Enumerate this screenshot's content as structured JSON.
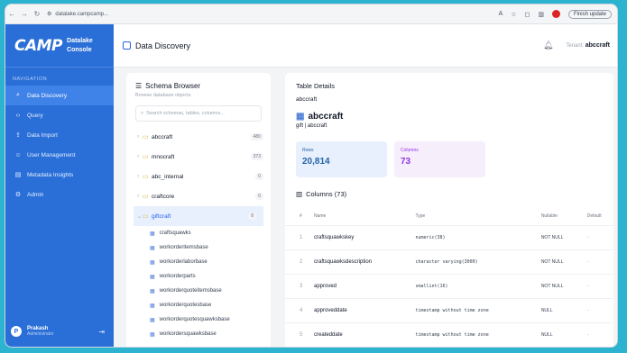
{
  "browser": {
    "url": "datalake.campcamp...",
    "update_label": "Finish update"
  },
  "brand": {
    "logo": "CAMP",
    "line1": "Datalake",
    "line2": "Console"
  },
  "sidebar": {
    "heading": "NAVIGATION",
    "items": [
      {
        "label": "Data Discovery",
        "icon": "search-icon"
      },
      {
        "label": "Query",
        "icon": "code-icon"
      },
      {
        "label": "Data Import",
        "icon": "upload-icon"
      },
      {
        "label": "User Management",
        "icon": "users-icon"
      },
      {
        "label": "Metadata Insights",
        "icon": "document-icon"
      },
      {
        "label": "Admin",
        "icon": "gear-icon"
      }
    ],
    "user": {
      "initial": "P",
      "name": "Prakash",
      "role": "Administrator"
    }
  },
  "header": {
    "title": "Data Discovery",
    "welcome_prefix": "Tenant:",
    "username": "abccraft"
  },
  "schema_browser": {
    "title": "Schema Browser",
    "subtitle": "Browse database objects",
    "search_placeholder": "Search schemas, tables, columns...",
    "schemas": [
      {
        "name": "abccraft",
        "count": "480"
      },
      {
        "name": "mnocraft",
        "count": "373"
      },
      {
        "name": "abc_internal",
        "count": "0"
      },
      {
        "name": "craftcore",
        "count": "0"
      },
      {
        "name": "giftcraft",
        "count": "8"
      }
    ],
    "tables": [
      "craftsquawks",
      "workorderitemsbase",
      "workorderlaborbase",
      "workorderparts",
      "workorderquoteitemsbase",
      "workorderquotesbase",
      "workorderquotesquawksbase",
      "workordersquawksbase"
    ]
  },
  "table_details": {
    "title": "Table Details",
    "database": "abccraft",
    "table_name": "abccraft",
    "path": "gift | abccraft",
    "rows_label": "Rows",
    "rows_value": "20,814",
    "columns_label": "Columns",
    "columns_value": "73",
    "columns_heading": "Columns (73)",
    "headers": [
      "#",
      "Name",
      "Type",
      "Nullable",
      "Default"
    ],
    "rows": [
      {
        "num": "1",
        "name": "craftsquawkskey",
        "type": "numeric(38)",
        "nullable": "NOT NULL",
        "default": "-"
      },
      {
        "num": "2",
        "name": "craftsquawksdescription",
        "type": "character varying(3000)",
        "nullable": "NOT NULL",
        "default": "-"
      },
      {
        "num": "3",
        "name": "approved",
        "type": "smallint(16)",
        "nullable": "NOT NULL",
        "default": "-"
      },
      {
        "num": "4",
        "name": "approveddate",
        "type": "timestamp without time zone",
        "nullable": "NULL",
        "default": "-"
      },
      {
        "num": "5",
        "name": "createddate",
        "type": "timestamp without time zone",
        "nullable": "NULL",
        "default": "-"
      }
    ]
  }
}
